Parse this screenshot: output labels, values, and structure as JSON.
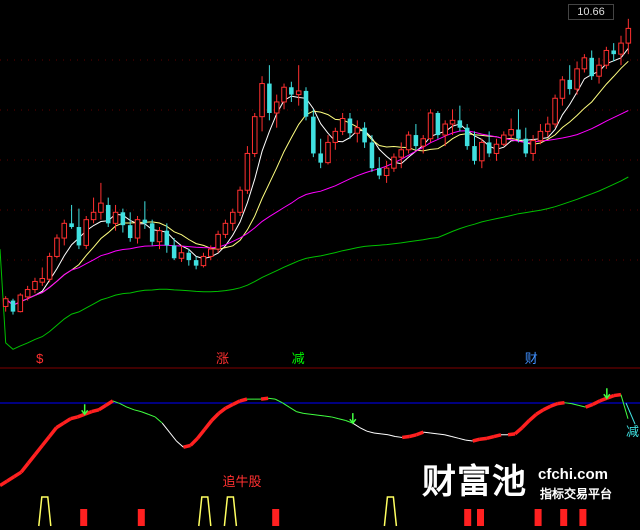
{
  "chart_data": {
    "type": "candlestick",
    "price_axis": {
      "max_label": "10.66",
      "ylim": [
        2.2,
        10.9
      ]
    },
    "x_count": 100,
    "candles": [
      [
        2.84,
        3.12,
        2.7,
        3.05
      ],
      [
        3.0,
        3.05,
        2.62,
        2.7
      ],
      [
        2.7,
        3.2,
        2.68,
        3.15
      ],
      [
        3.1,
        3.4,
        3.0,
        3.3
      ],
      [
        3.3,
        3.62,
        3.2,
        3.52
      ],
      [
        3.5,
        3.9,
        3.4,
        3.6
      ],
      [
        3.58,
        4.3,
        3.5,
        4.2
      ],
      [
        4.2,
        4.8,
        4.15,
        4.7
      ],
      [
        4.7,
        5.2,
        4.5,
        5.1
      ],
      [
        5.1,
        5.6,
        4.95,
        5.0
      ],
      [
        5.0,
        5.5,
        4.4,
        4.5
      ],
      [
        4.5,
        5.3,
        4.4,
        5.2
      ],
      [
        5.2,
        5.8,
        5.1,
        5.4
      ],
      [
        5.4,
        6.2,
        5.2,
        5.65
      ],
      [
        5.6,
        5.8,
        5.0,
        5.1
      ],
      [
        5.1,
        5.6,
        4.9,
        5.4
      ],
      [
        5.4,
        5.5,
        4.85,
        5.05
      ],
      [
        5.05,
        5.4,
        4.6,
        4.7
      ],
      [
        4.7,
        5.3,
        4.55,
        5.2
      ],
      [
        5.2,
        5.7,
        4.95,
        5.1
      ],
      [
        5.1,
        5.2,
        4.5,
        4.6
      ],
      [
        4.6,
        5.0,
        4.4,
        4.9
      ],
      [
        4.9,
        5.1,
        4.3,
        4.5
      ],
      [
        4.5,
        4.7,
        4.1,
        4.15
      ],
      [
        4.15,
        4.5,
        4.05,
        4.3
      ],
      [
        4.3,
        4.4,
        3.95,
        4.1
      ],
      [
        4.1,
        4.2,
        3.85,
        3.95
      ],
      [
        3.95,
        4.3,
        3.9,
        4.2
      ],
      [
        4.2,
        4.5,
        4.1,
        4.4
      ],
      [
        4.4,
        4.9,
        4.3,
        4.8
      ],
      [
        4.8,
        5.2,
        4.7,
        5.1
      ],
      [
        5.1,
        5.5,
        4.9,
        5.4
      ],
      [
        5.4,
        6.1,
        5.3,
        6.0
      ],
      [
        6.0,
        7.2,
        5.9,
        7.0
      ],
      [
        7.0,
        8.1,
        6.9,
        8.0
      ],
      [
        8.0,
        9.1,
        7.6,
        8.9
      ],
      [
        8.9,
        9.4,
        7.9,
        8.1
      ],
      [
        8.1,
        8.6,
        7.7,
        8.4
      ],
      [
        8.4,
        8.9,
        8.2,
        8.8
      ],
      [
        8.8,
        8.95,
        8.4,
        8.6
      ],
      [
        8.6,
        9.4,
        8.3,
        8.7
      ],
      [
        8.7,
        8.8,
        7.9,
        8.0
      ],
      [
        8.0,
        8.2,
        6.9,
        7.0
      ],
      [
        7.0,
        7.4,
        6.6,
        6.75
      ],
      [
        6.75,
        7.5,
        6.7,
        7.3
      ],
      [
        7.3,
        7.7,
        7.1,
        7.6
      ],
      [
        7.6,
        8.1,
        7.5,
        7.95
      ],
      [
        7.95,
        8.1,
        7.4,
        7.55
      ],
      [
        7.55,
        7.9,
        7.3,
        7.7
      ],
      [
        7.7,
        7.85,
        7.15,
        7.3
      ],
      [
        7.3,
        7.5,
        6.5,
        6.6
      ],
      [
        6.6,
        6.9,
        6.3,
        6.4
      ],
      [
        6.4,
        6.8,
        6.2,
        6.6
      ],
      [
        6.6,
        7.0,
        6.5,
        6.9
      ],
      [
        6.9,
        7.3,
        6.6,
        7.1
      ],
      [
        7.1,
        7.6,
        7.0,
        7.5
      ],
      [
        7.5,
        7.8,
        7.1,
        7.2
      ],
      [
        7.2,
        7.5,
        7.0,
        7.4
      ],
      [
        7.4,
        8.2,
        7.3,
        8.1
      ],
      [
        8.1,
        8.15,
        7.4,
        7.5
      ],
      [
        7.5,
        7.9,
        7.2,
        7.8
      ],
      [
        7.8,
        8.2,
        7.5,
        7.9
      ],
      [
        7.9,
        8.3,
        7.6,
        7.7
      ],
      [
        7.7,
        7.8,
        7.1,
        7.2
      ],
      [
        7.2,
        7.6,
        6.7,
        6.8
      ],
      [
        6.8,
        7.4,
        6.6,
        7.3
      ],
      [
        7.3,
        7.6,
        6.9,
        7.0
      ],
      [
        7.0,
        7.4,
        6.8,
        7.25
      ],
      [
        7.25,
        7.6,
        7.2,
        7.5
      ],
      [
        7.5,
        7.95,
        7.4,
        7.65
      ],
      [
        7.65,
        8.2,
        7.3,
        7.4
      ],
      [
        7.4,
        7.7,
        6.9,
        7.0
      ],
      [
        7.0,
        7.5,
        6.8,
        7.35
      ],
      [
        7.35,
        7.8,
        7.25,
        7.6
      ],
      [
        7.6,
        8.0,
        7.45,
        7.8
      ],
      [
        7.8,
        8.6,
        7.7,
        8.5
      ],
      [
        8.5,
        9.1,
        8.3,
        9.0
      ],
      [
        9.0,
        9.4,
        8.6,
        8.75
      ],
      [
        8.75,
        9.5,
        8.6,
        9.3
      ],
      [
        9.3,
        9.7,
        9.2,
        9.6
      ],
      [
        9.6,
        9.8,
        9.0,
        9.1
      ],
      [
        9.1,
        9.6,
        8.9,
        9.4
      ],
      [
        9.4,
        9.9,
        9.3,
        9.8
      ],
      [
        9.8,
        10.0,
        9.5,
        9.7
      ],
      [
        9.7,
        10.2,
        9.4,
        10.0
      ],
      [
        10.0,
        10.66,
        9.7,
        10.4
      ]
    ],
    "ma_lines": [
      {
        "color": "#ffffff"
      },
      {
        "color": "#ffff80"
      },
      {
        "color": "#ff00ff"
      },
      {
        "color": "#00c000"
      }
    ],
    "signal_labels": [
      {
        "text": "$",
        "color": "#ff3030",
        "x": 6
      },
      {
        "text": "涨",
        "color": "#ff3030",
        "x": 35
      },
      {
        "text": "减",
        "color": "#00ff00",
        "x": 47
      },
      {
        "text": "财",
        "color": "#4090ff",
        "x": 84
      }
    ],
    "indicator": {
      "reference_line_color": "#0000ff",
      "right_label": "减",
      "annotation": "追牛股",
      "values": [
        0.05,
        0.1,
        0.15,
        0.2,
        0.3,
        0.4,
        0.5,
        0.6,
        0.7,
        0.75,
        0.8,
        0.82,
        0.85,
        0.88,
        0.9,
        0.95,
        1.0,
        0.97,
        0.93,
        0.9,
        0.88,
        0.85,
        0.82,
        0.75,
        0.65,
        0.55,
        0.48,
        0.5,
        0.58,
        0.68,
        0.78,
        0.86,
        0.92,
        0.96,
        1.0,
        1.02,
        1.02,
        1.02,
        1.03,
        1.02,
        0.98,
        0.93,
        0.88,
        0.86,
        0.85,
        0.84,
        0.83,
        0.82,
        0.8,
        0.78,
        0.75,
        0.7,
        0.66,
        0.64,
        0.63,
        0.62,
        0.6,
        0.59,
        0.6,
        0.62,
        0.65,
        0.64,
        0.63,
        0.62,
        0.6,
        0.58,
        0.56,
        0.55,
        0.57,
        0.58,
        0.6,
        0.62,
        0.62,
        0.63,
        0.7,
        0.78,
        0.85,
        0.9,
        0.94,
        0.97,
        0.98,
        0.97,
        0.95,
        0.93,
        0.96,
        1.0,
        1.03,
        1.06,
        1.07,
        0.8
      ]
    },
    "bars": {
      "pulses_yellow": [
        7,
        32,
        36,
        61
      ],
      "red_bars": [
        13,
        22,
        43,
        73,
        75,
        84,
        88,
        91
      ]
    }
  },
  "watermark": {
    "brand": "财富池",
    "site": "cfchi.com",
    "tagline": "指标交易平台"
  }
}
